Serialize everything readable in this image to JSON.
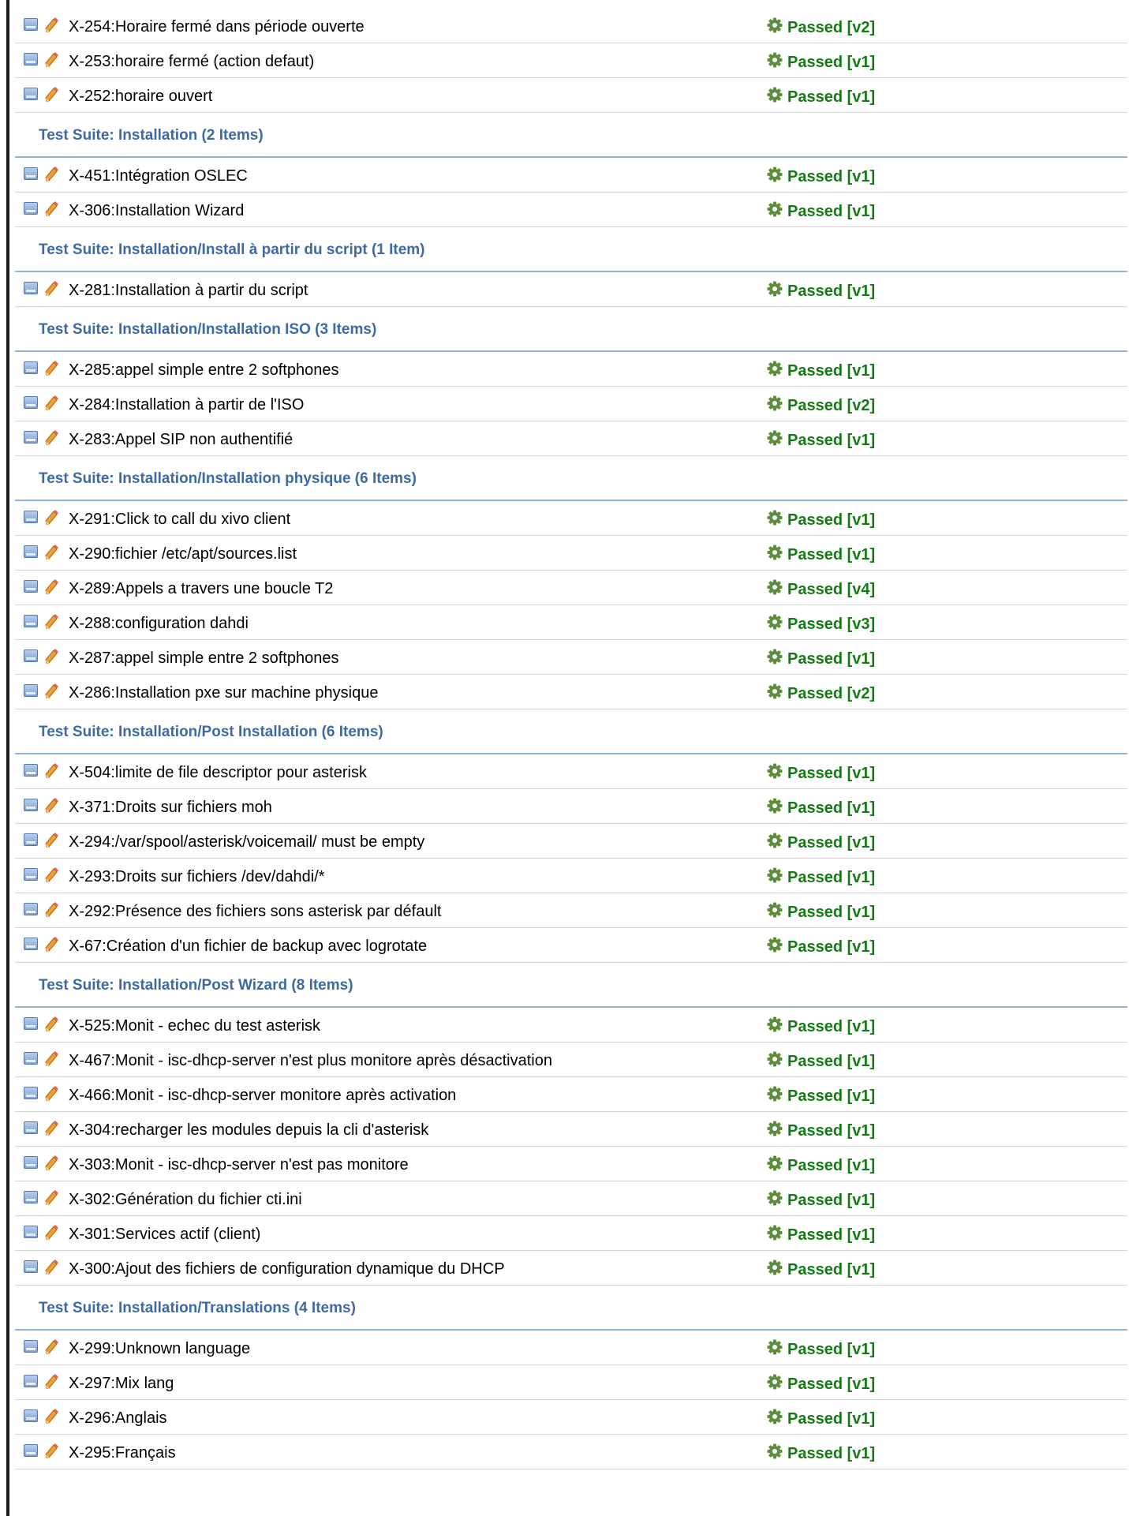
{
  "colors": {
    "suite_title": "#3d69a6",
    "passed": "#147a14",
    "row_border": "#d4d4d4",
    "suite_border": "#93b2da"
  },
  "icons": {
    "view": "book-icon",
    "edit": "pencil-icon",
    "status": "gear-icon"
  },
  "sections": [
    {
      "suite": "",
      "items": [
        {
          "label": "X-254:Horaire fermé dans période ouverte",
          "status": "Passed [v2]"
        },
        {
          "label": "X-253:horaire fermé (action defaut)",
          "status": "Passed [v1]"
        },
        {
          "label": "X-252:horaire ouvert",
          "status": "Passed [v1]"
        }
      ]
    },
    {
      "suite": "Test Suite: Installation (2 Items)",
      "items": [
        {
          "label": "X-451:Intégration OSLEC",
          "status": "Passed [v1]"
        },
        {
          "label": "X-306:Installation Wizard",
          "status": "Passed [v1]"
        }
      ]
    },
    {
      "suite": "Test Suite: Installation/Install à partir du script (1 Item)",
      "items": [
        {
          "label": "X-281:Installation à partir du script",
          "status": "Passed [v1]"
        }
      ]
    },
    {
      "suite": "Test Suite: Installation/Installation ISO (3 Items)",
      "items": [
        {
          "label": "X-285:appel simple entre 2 softphones",
          "status": "Passed [v1]"
        },
        {
          "label": "X-284:Installation à partir de l'ISO",
          "status": "Passed [v2]"
        },
        {
          "label": "X-283:Appel SIP non authentifié",
          "status": "Passed [v1]"
        }
      ]
    },
    {
      "suite": "Test Suite: Installation/Installation physique (6 Items)",
      "items": [
        {
          "label": "X-291:Click to call du xivo client",
          "status": "Passed [v1]"
        },
        {
          "label": "X-290:fichier /etc/apt/sources.list",
          "status": "Passed [v1]"
        },
        {
          "label": "X-289:Appels a travers une boucle T2",
          "status": "Passed [v4]"
        },
        {
          "label": "X-288:configuration dahdi",
          "status": "Passed [v3]"
        },
        {
          "label": "X-287:appel simple entre 2 softphones",
          "status": "Passed [v1]"
        },
        {
          "label": "X-286:Installation pxe sur machine physique",
          "status": "Passed [v2]"
        }
      ]
    },
    {
      "suite": "Test Suite: Installation/Post Installation (6 Items)",
      "items": [
        {
          "label": "X-504:limite de file descriptor pour asterisk",
          "status": "Passed [v1]"
        },
        {
          "label": "X-371:Droits sur fichiers moh",
          "status": "Passed [v1]"
        },
        {
          "label": "X-294:/var/spool/asterisk/voicemail/ must be empty",
          "status": "Passed [v1]"
        },
        {
          "label": "X-293:Droits sur fichiers /dev/dahdi/*",
          "status": "Passed [v1]"
        },
        {
          "label": "X-292:Présence des fichiers sons asterisk par défault",
          "status": "Passed [v1]"
        },
        {
          "label": "X-67:Création d'un fichier de backup avec logrotate",
          "status": "Passed [v1]"
        }
      ]
    },
    {
      "suite": "Test Suite: Installation/Post Wizard (8 Items)",
      "items": [
        {
          "label": "X-525:Monit - echec du test asterisk",
          "status": "Passed [v1]"
        },
        {
          "label": "X-467:Monit - isc-dhcp-server n'est plus monitore après désactivation",
          "status": "Passed [v1]"
        },
        {
          "label": "X-466:Monit - isc-dhcp-server monitore après activation",
          "status": "Passed [v1]"
        },
        {
          "label": "X-304:recharger les modules depuis la cli d'asterisk",
          "status": "Passed [v1]"
        },
        {
          "label": "X-303:Monit - isc-dhcp-server n'est pas monitore",
          "status": "Passed [v1]"
        },
        {
          "label": "X-302:Génération du fichier cti.ini",
          "status": "Passed [v1]"
        },
        {
          "label": "X-301:Services actif (client)",
          "status": "Passed [v1]"
        },
        {
          "label": "X-300:Ajout des fichiers de configuration dynamique du DHCP",
          "status": "Passed [v1]"
        }
      ]
    },
    {
      "suite": "Test Suite: Installation/Translations (4 Items)",
      "items": [
        {
          "label": "X-299:Unknown language",
          "status": "Passed [v1]"
        },
        {
          "label": "X-297:Mix lang",
          "status": "Passed [v1]"
        },
        {
          "label": "X-296:Anglais",
          "status": "Passed [v1]"
        },
        {
          "label": "X-295:Français",
          "status": "Passed [v1]"
        }
      ]
    }
  ]
}
